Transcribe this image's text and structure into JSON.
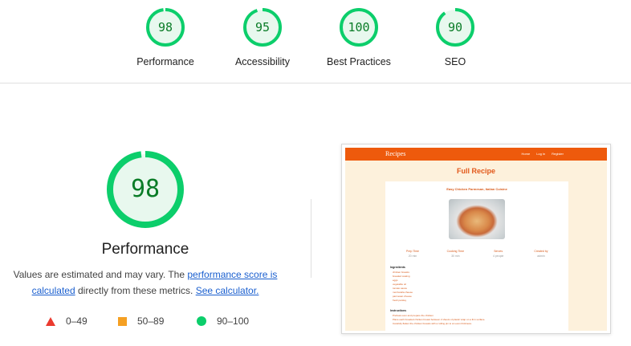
{
  "summary": [
    {
      "score": "98",
      "label": "Performance"
    },
    {
      "score": "95",
      "label": "Accessibility"
    },
    {
      "score": "100",
      "label": "Best Practices"
    },
    {
      "score": "90",
      "label": "SEO"
    }
  ],
  "performance": {
    "score": "98",
    "title": "Performance",
    "desc_prefix": "Values are estimated and may vary. The ",
    "link_score": "performance score is calculated",
    "desc_middle": " directly from these metrics. ",
    "link_calculator": "See calculator."
  },
  "legend": {
    "fail": "0–49",
    "average": "50–89",
    "pass": "90–100"
  },
  "colors": {
    "pass": "#0cce6b",
    "pass_text": "#0a7c27",
    "pass_bg": "#e8f8ee",
    "average": "#f5a023",
    "fail": "#eb3a2f",
    "link": "#1a5fcf",
    "brand_orange": "#ee5a0c"
  },
  "screenshot": {
    "brand": "Recipes",
    "nav_links": [
      "Home",
      "Log in",
      "Register"
    ],
    "heading": "Full Recipe",
    "recipe_title": "Easy Chicken Parmesan, Italian Cuisine",
    "meta": [
      {
        "label": "Prep Time",
        "value": "20 min"
      },
      {
        "label": "Cooking Time",
        "value": "30 min"
      },
      {
        "label": "Serves",
        "value": "4 people"
      },
      {
        "label": "Created by",
        "value": "admin"
      }
    ],
    "ingredients_heading": "Ingredients",
    "ingredients": [
      "chicken breasts",
      "breaded coating",
      "eggs",
      "vegetable oil",
      "tomato sauce",
      "mozzarella cheese",
      "parmesan cheese",
      "fresh parsley"
    ],
    "instructions_heading": "Instructions",
    "instructions": [
      "Preheat oven and prepare the chicken",
      "Place each breaded chicken breast between 2 sheets of plastic wrap on a firm surface.",
      "Carefully flatten the chicken breasts with a rolling pin to an even thickness."
    ]
  }
}
